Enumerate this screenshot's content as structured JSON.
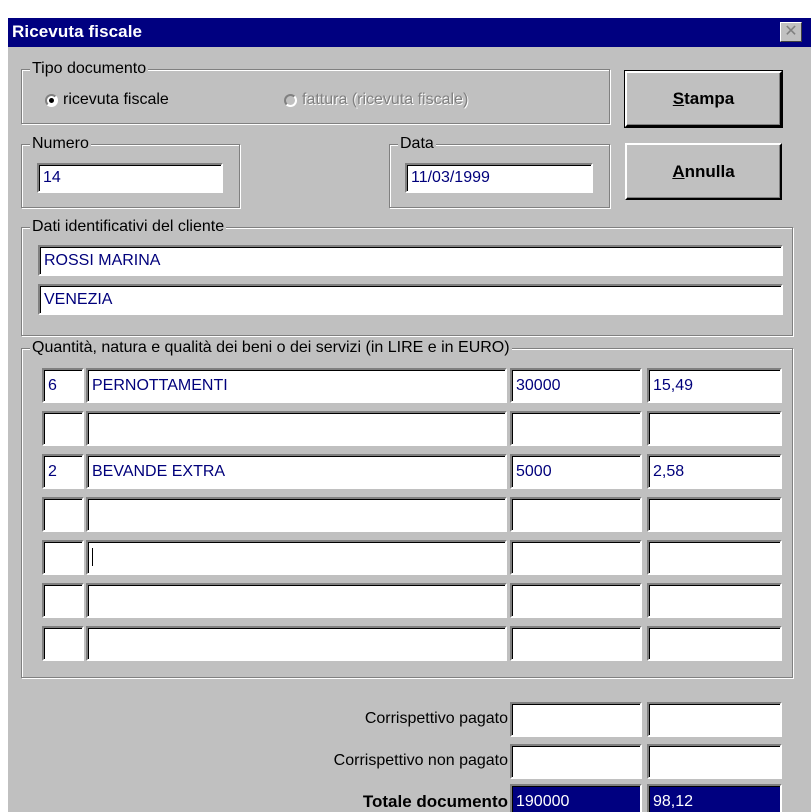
{
  "window": {
    "title": "Ricevuta fiscale",
    "close_symbol": "✕"
  },
  "tipo_documento": {
    "legend": "Tipo documento",
    "option_ricevuta": "ricevuta fiscale",
    "option_fattura": "fattura (ricevuta fiscale)",
    "selected": "ricevuta fiscale"
  },
  "buttons": {
    "stampa_first": "S",
    "stampa_rest": "tampa",
    "annulla_first": "A",
    "annulla_rest": "nnulla"
  },
  "numero": {
    "legend": "Numero",
    "value": "14"
  },
  "data": {
    "legend": "Data",
    "value": "11/03/1999"
  },
  "cliente": {
    "legend": "Dati identificativi del cliente",
    "name": "ROSSI MARINA",
    "city": "VENEZIA"
  },
  "beni": {
    "legend": "Quantità, natura e qualità dei beni o dei servizi (in LIRE e in EURO)",
    "rows": [
      {
        "qty": "6",
        "desc": "PERNOTTAMENTI",
        "lire": "30000",
        "euro": "15,49"
      },
      {
        "qty": "",
        "desc": "",
        "lire": "",
        "euro": ""
      },
      {
        "qty": "2",
        "desc": "BEVANDE EXTRA",
        "lire": "5000",
        "euro": "2,58"
      },
      {
        "qty": "",
        "desc": "",
        "lire": "",
        "euro": ""
      },
      {
        "qty": "",
        "desc": "",
        "lire": "",
        "euro": ""
      },
      {
        "qty": "",
        "desc": "",
        "lire": "",
        "euro": ""
      },
      {
        "qty": "",
        "desc": "",
        "lire": "",
        "euro": ""
      }
    ]
  },
  "totali": {
    "pagato_label": "Corrispettivo pagato",
    "pagato_lire": "",
    "pagato_euro": "",
    "non_pagato_label": "Corrispettivo non pagato",
    "non_pagato_lire": "",
    "non_pagato_euro": "",
    "totale_label": "Totale documento",
    "totale_lire": "190000",
    "totale_euro": "98,12"
  },
  "colors": {
    "title_bar": "#000080",
    "window_bg": "#c0c0c0",
    "field_text": "#00007b",
    "total_bg": "#000080"
  }
}
